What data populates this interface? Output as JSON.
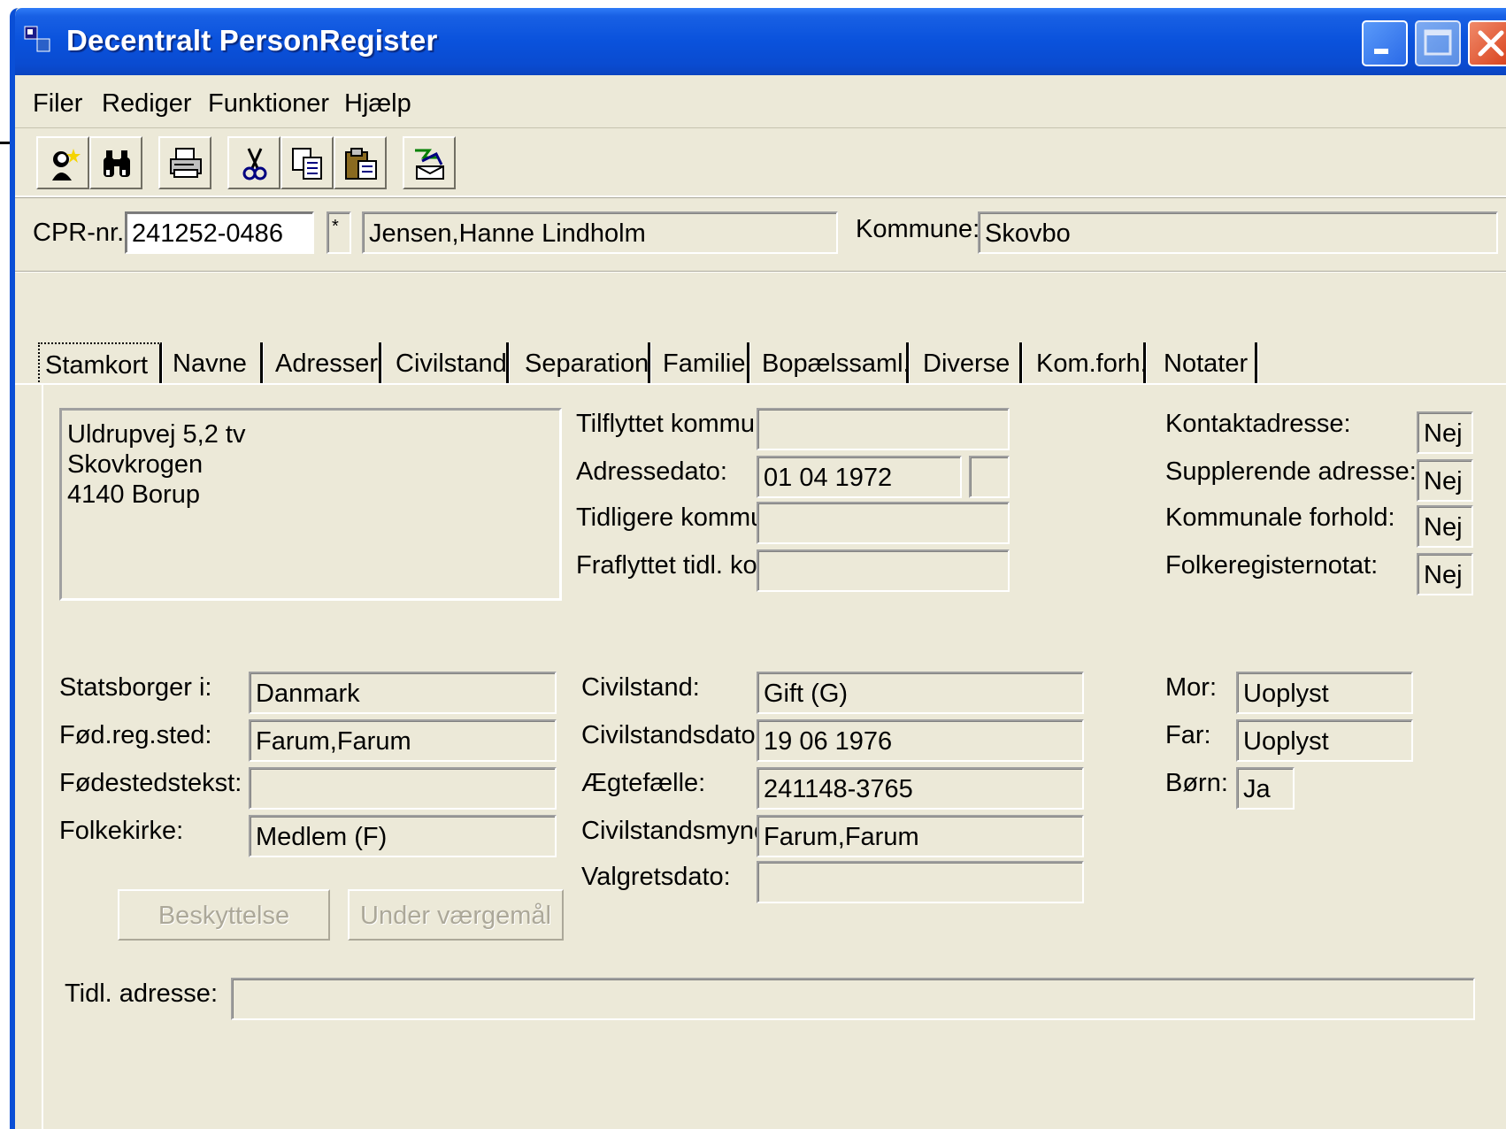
{
  "window": {
    "title": "Decentralt PersonRegister"
  },
  "menu": [
    {
      "label": "Filer"
    },
    {
      "label": "Rediger"
    },
    {
      "label": "Funktioner"
    },
    {
      "label": "Hjælp"
    }
  ],
  "toolbar": {
    "icons": [
      "new-person-icon",
      "search-binoculars-icon",
      "print-icon",
      "cut-icon",
      "copy-icon",
      "paste-icon",
      "transfer-icon"
    ]
  },
  "header": {
    "cpr_label": "CPR-nr.:",
    "cpr_value": "241252-0486",
    "marker": "*",
    "name": "Jensen,Hanne Lindholm",
    "kommune_label": "Kommune:",
    "kommune_value": "Skovbo"
  },
  "tabs": [
    {
      "label": "Stamkort",
      "active": true
    },
    {
      "label": "Navne"
    },
    {
      "label": "Adresser"
    },
    {
      "label": "Civilstand"
    },
    {
      "label": "Separation"
    },
    {
      "label": "Familie"
    },
    {
      "label": "Bopælssaml."
    },
    {
      "label": "Diverse"
    },
    {
      "label": "Kom.forh."
    },
    {
      "label": "Notater"
    }
  ],
  "address": {
    "line1": "Uldrupvej 5,2 tv",
    "line2": "Skovkrogen",
    "line3": "4140 Borup"
  },
  "address_info": {
    "tilflyttet_label": "Tilflyttet kommunen:",
    "tilflyttet_value": "",
    "adressedato_label": "Adressedato:",
    "adressedato_value": "01 04 1972",
    "tidligere_label": "Tidligere kommune:",
    "tidligere_value": "",
    "fraflyttet_label": "Fraflyttet tidl. kom.:",
    "fraflyttet_value": ""
  },
  "flags": {
    "kontakt_label": "Kontaktadresse:",
    "kontakt_value": "Nej",
    "supplerende_label": "Supplerende adresse:",
    "supplerende_value": "Nej",
    "kommunale_label": "Kommunale forhold:",
    "kommunale_value": "Nej",
    "folkeregister_label": "Folkeregisternotat:",
    "folkeregister_value": "Nej"
  },
  "personal": {
    "statsborger_label": "Statsborger i:",
    "statsborger_value": "Danmark",
    "fodreg_label": "Fød.reg.sted:",
    "fodreg_value": "Farum,Farum",
    "fodested_label": "Fødestedstekst:",
    "fodested_value": "",
    "folkekirke_label": "Folkekirke:",
    "folkekirke_value": "Medlem (F)"
  },
  "civil": {
    "civilstand_label": "Civilstand:",
    "civilstand_value": "Gift (G)",
    "civildato_label": "Civilstandsdato:",
    "civildato_value": "19 06 1976",
    "aegtefaelle_label": "Ægtefælle:",
    "aegtefaelle_value": "241148-3765",
    "myndighed_label": "Civilstandsmynd.:",
    "myndighed_value": "Farum,Farum",
    "valgret_label": "Valgretsdato:",
    "valgret_value": ""
  },
  "family": {
    "mor_label": "Mor:",
    "mor_value": "Uoplyst",
    "far_label": "Far:",
    "far_value": "Uoplyst",
    "born_label": "Børn:",
    "born_value": "Ja"
  },
  "buttons": {
    "beskyttelse": "Beskyttelse",
    "vaergemaal": "Under værgemål"
  },
  "tidl_adresse": {
    "label": "Tidl. adresse:",
    "value": ""
  }
}
